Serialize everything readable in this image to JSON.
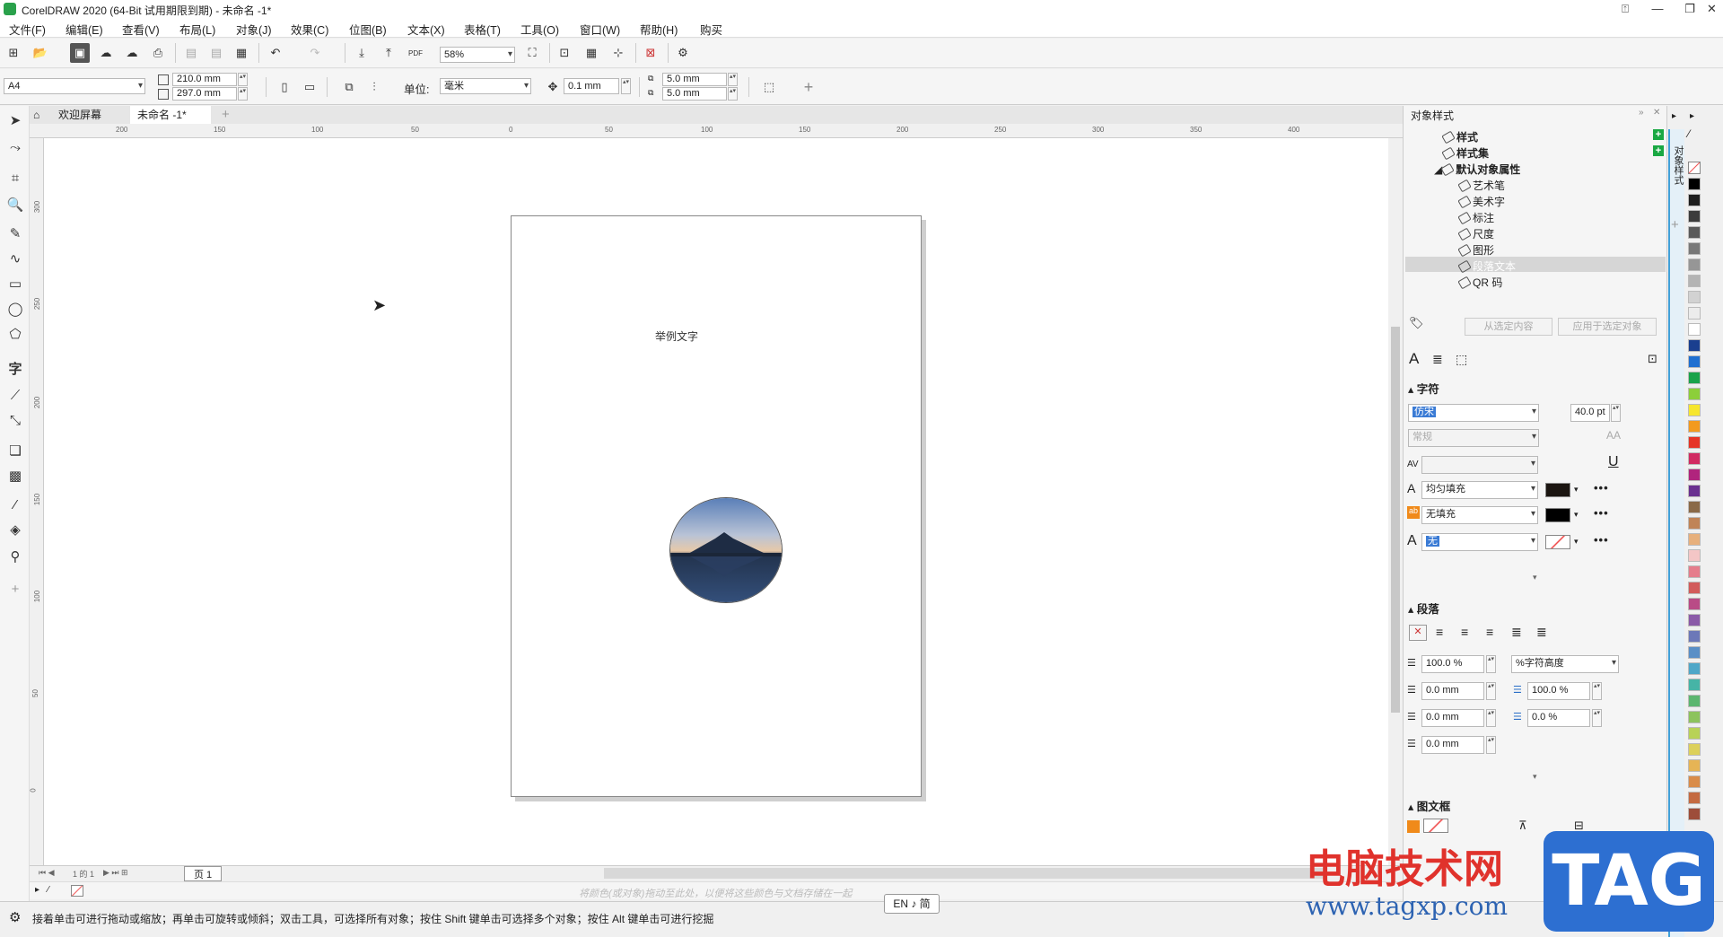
{
  "window": {
    "title": "CorelDRAW 2020 (64-Bit 试用期限到期) - 未命名 -1*"
  },
  "menu": [
    "文件(F)",
    "编辑(E)",
    "查看(V)",
    "布局(L)",
    "对象(J)",
    "效果(C)",
    "位图(B)",
    "文本(X)",
    "表格(T)",
    "工具(O)",
    "窗口(W)",
    "帮助(H)",
    "购买"
  ],
  "toolbar": {
    "zoom": "58%"
  },
  "propbar": {
    "page_size": "A4",
    "width": "210.0 mm",
    "height": "297.0 mm",
    "unit_label": "单位:",
    "unit": "毫米",
    "nudge": "0.1 mm",
    "dup_x": "5.0 mm",
    "dup_y": "5.0 mm"
  },
  "tabs": {
    "welcome": "欢迎屏幕",
    "document": "未命名 -1*"
  },
  "ruler": {
    "h_labels": [
      "200",
      "150",
      "100",
      "50",
      "0",
      "50",
      "100",
      "150",
      "200",
      "250",
      "300",
      "350",
      "400"
    ],
    "v_labels": [
      "300",
      "250",
      "200",
      "150",
      "100",
      "50",
      "0"
    ]
  },
  "page": {
    "sample_text": "举例文字"
  },
  "pagebar": {
    "pages": "1 的 1",
    "tab": "页 1"
  },
  "colorbar": {
    "hint": "将颜色(或对象)拖动至此处，以便将这些颜色与文档存储在一起"
  },
  "status": {
    "text": "接着单击可进行拖动或缩放；再单击可旋转或倾斜；双击工具，可选择所有对象；按住 Shift 键单击可选择多个对象；按住 Alt 键单击可进行挖掘"
  },
  "ime": "EN ♪ 简",
  "docker": {
    "title": "对象样式",
    "vertical_tab": "对象样式",
    "tree": [
      {
        "label": "样式",
        "bold": true,
        "level": 0
      },
      {
        "label": "样式集",
        "bold": true,
        "level": 0
      },
      {
        "label": "默认对象属性",
        "bold": true,
        "level": 0
      },
      {
        "label": "艺术笔",
        "bold": false,
        "level": 1
      },
      {
        "label": "美术字",
        "bold": false,
        "level": 1
      },
      {
        "label": "标注",
        "bold": false,
        "level": 1
      },
      {
        "label": "尺度",
        "bold": false,
        "level": 1
      },
      {
        "label": "图形",
        "bold": false,
        "level": 1
      },
      {
        "label": "段落文本",
        "bold": false,
        "level": 1
      },
      {
        "label": "QR 码",
        "bold": false,
        "level": 1
      }
    ],
    "btn_from_selection": "从选定内容",
    "btn_apply": "应用于选定对象",
    "char_section": "字符",
    "font": "仿宋",
    "font_size": "40.0 pt",
    "font_style": "常规",
    "fill_uniform": "均匀填充",
    "fill_none": "无填充",
    "outline_none": "无",
    "para_section": "段落",
    "line_spacing": "100.0 %",
    "line_spacing_unit": "%字符高度",
    "indent_first": "0.0 mm",
    "indent_left": "0.0 mm",
    "indent_right": "0.0 mm",
    "char_spacing": "100.0 %",
    "word_spacing": "0.0 %",
    "frame_section": "图文框"
  },
  "palette": [
    "#000000",
    "#1f1f1f",
    "#3c3c3c",
    "#5a5a5a",
    "#787878",
    "#969696",
    "#b4b4b4",
    "#d2d2d2",
    "#ececec",
    "#ffffff",
    "#1a3f8f",
    "#1f6fd1",
    "#19a34a",
    "#8ccf3a",
    "#f6e62d",
    "#f39a1e",
    "#e53427",
    "#d12b62",
    "#b0247d",
    "#6a3190",
    "#8a6a48",
    "#c08457",
    "#e7b07c",
    "#f4c6c6",
    "#e57d8c",
    "#d25b5b",
    "#b94b86",
    "#8b5aa8",
    "#6c78b8",
    "#5a8fc6",
    "#4fa7c8",
    "#46b4a6",
    "#5cb66f",
    "#8cc35c",
    "#b8d257",
    "#dcd05b",
    "#e6b455",
    "#d98c4a",
    "#c46a41",
    "#9d4d3a"
  ],
  "watermark": {
    "line1": "电脑技术网",
    "line2": "www.tagxp.com",
    "tag": "TAG"
  }
}
